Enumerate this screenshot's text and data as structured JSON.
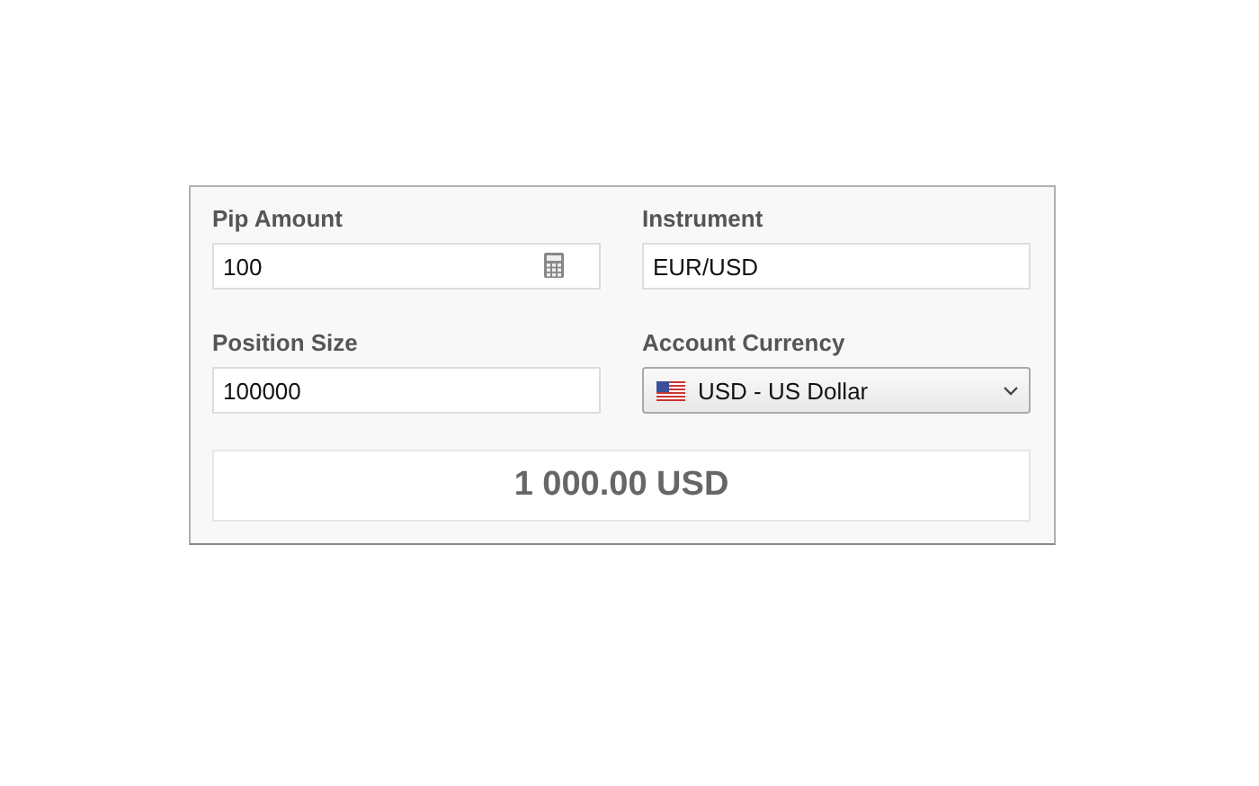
{
  "fields": [
    {
      "label": "Pip Amount",
      "kind": "calculator",
      "value": "100"
    },
    {
      "label": "Instrument",
      "kind": "text",
      "value": "EUR/USD"
    },
    {
      "label": "Position Size",
      "kind": "text",
      "value": "100000"
    },
    {
      "label": "Account Currency",
      "kind": "select",
      "value": "USD - US Dollar"
    }
  ],
  "result": "1 000.00 USD"
}
